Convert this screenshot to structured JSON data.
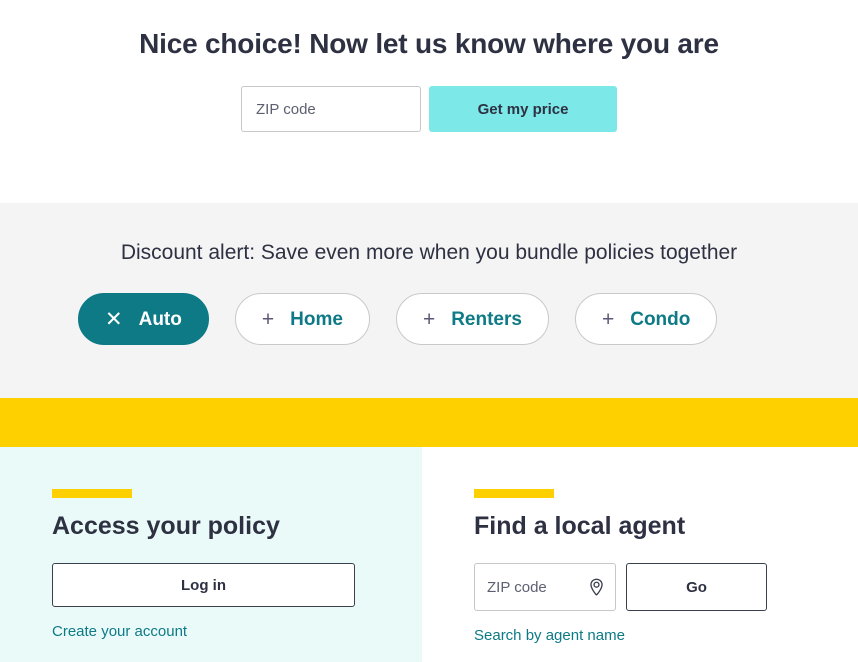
{
  "hero": {
    "title": "Nice choice! Now let us know where you are",
    "zip_placeholder": "ZIP code",
    "zip_value": "",
    "submit_label": "Get my price",
    "accent_color": "#7de8e8"
  },
  "bundle": {
    "message": "Discount alert: Save even more when you bundle policies together",
    "background": "#f4f4f4",
    "selected_color": "#0d7a86",
    "chips": [
      {
        "label": "Auto",
        "glyph": "✕",
        "icon": "close-icon",
        "selected": true
      },
      {
        "label": "Home",
        "glyph": "+",
        "icon": "plus-icon",
        "selected": false
      },
      {
        "label": "Renters",
        "glyph": "+",
        "icon": "plus-icon",
        "selected": false
      },
      {
        "label": "Condo",
        "glyph": "+",
        "icon": "plus-icon",
        "selected": false
      }
    ]
  },
  "divider": {
    "color": "#ffd000"
  },
  "panels": {
    "policy": {
      "title": "Access your policy",
      "button_label": "Log in",
      "link_label": "Create your account",
      "accent_color": "#ffd000",
      "background": "#eafaf9"
    },
    "agent": {
      "title": "Find a local agent",
      "zip_placeholder": "ZIP code",
      "zip_value": "",
      "zip_icon": "map-pin-icon",
      "button_label": "Go",
      "link_label": "Search by agent name",
      "accent_color": "#ffd000",
      "background": "#ffffff"
    }
  }
}
